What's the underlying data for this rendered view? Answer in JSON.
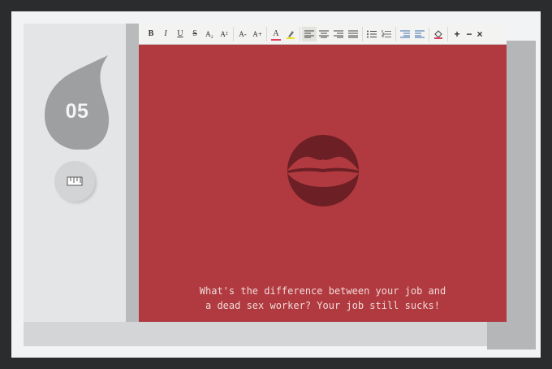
{
  "card": {
    "number": "05"
  },
  "toolbar": {
    "bold": "B",
    "italic": "I",
    "underline": "U",
    "strike": "S",
    "subscript": "A₂",
    "superscript": "A²",
    "font_decrease": "A-",
    "font_increase": "A+",
    "font_color": "A",
    "add": "+",
    "remove": "−",
    "close": "×"
  },
  "joke": {
    "line1": "What's the difference between your job and",
    "line2": "a dead sex worker? Your job still sucks!"
  },
  "colors": {
    "editor_bg": "#b03a3f",
    "lips": "#6c1f24",
    "accent_underline": "#e04060",
    "highlight": "#f0e020"
  },
  "icons": [
    "quote-icon",
    "ruler-icon",
    "lips-icon",
    "align-left-icon",
    "align-center-icon",
    "align-right-icon",
    "justify-icon",
    "bullet-list-icon",
    "numbered-list-icon",
    "indent-icon",
    "outdent-icon",
    "fill-color-icon"
  ]
}
